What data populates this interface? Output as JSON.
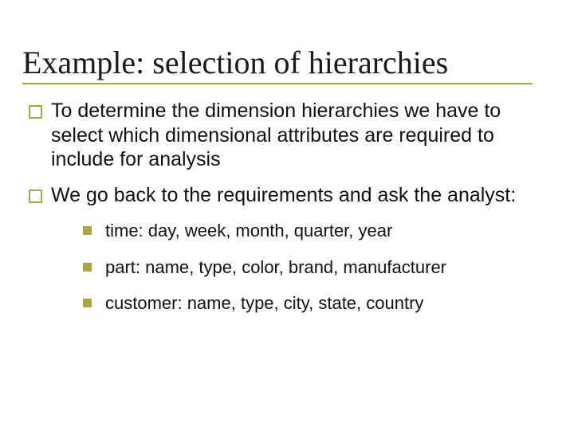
{
  "title": "Example: selection of hierarchies",
  "bullets": [
    {
      "text": "To determine the dimension hierarchies we have to select which dimensional attributes are required to include for analysis",
      "sub": []
    },
    {
      "text": "We go back to the requirements and ask the analyst:",
      "sub": [
        "time: day, week, month, quarter, year",
        "part: name, type, color, brand, manufacturer",
        "customer: name, type, city, state, country"
      ]
    }
  ]
}
